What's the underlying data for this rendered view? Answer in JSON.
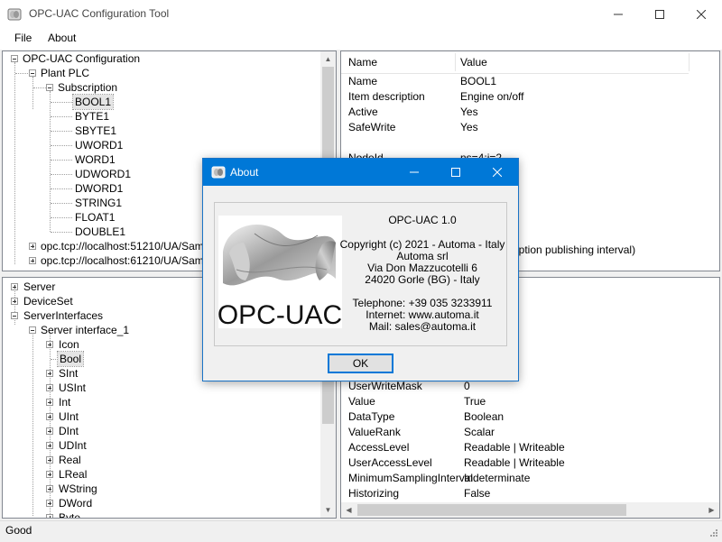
{
  "window": {
    "title": "OPC-UAC Configuration Tool"
  },
  "menu": [
    "File",
    "About"
  ],
  "tree_top": {
    "root": "OPC-UAC Configuration",
    "plc": "Plant PLC",
    "subscription": "Subscription",
    "items": [
      "BOOL1",
      "BYTE1",
      "SBYTE1",
      "UWORD1",
      "WORD1",
      "UDWORD1",
      "DWORD1",
      "STRING1",
      "FLOAT1",
      "DOUBLE1"
    ],
    "servers": [
      "opc.tcp://localhost:51210/UA/Sampl",
      "opc.tcp://localhost:61210/UA/Sampl"
    ]
  },
  "tree_bottom": {
    "top_nodes": [
      "Server",
      "DeviceSet",
      "ServerInterfaces"
    ],
    "interface": "Server interface_1",
    "items": [
      "Icon",
      "Bool",
      "SInt",
      "USInt",
      "Int",
      "UInt",
      "DInt",
      "UDInt",
      "Real",
      "LReal",
      "WString",
      "DWord",
      "Byte"
    ]
  },
  "grid_top": {
    "col_name": "Name",
    "col_value": "Value",
    "rows": [
      {
        "name": "Name",
        "value": "BOOL1"
      },
      {
        "name": "Item description",
        "value": "Engine on/off"
      },
      {
        "name": "Active",
        "value": "Yes"
      },
      {
        "name": "SafeWrite",
        "value": "Yes"
      }
    ],
    "partial_row_name": "NodeId",
    "partial_row_value": "ns=4;i=2",
    "partial_desc": "ription publishing interval)"
  },
  "grid_bottom": {
    "rows": [
      {
        "name": "UserWriteMask",
        "value": "0"
      },
      {
        "name": "Value",
        "value": "True"
      },
      {
        "name": "DataType",
        "value": "Boolean"
      },
      {
        "name": "ValueRank",
        "value": "Scalar"
      },
      {
        "name": "AccessLevel",
        "value": "Readable | Writeable"
      },
      {
        "name": "UserAccessLevel",
        "value": "Readable | Writeable"
      },
      {
        "name": "MinimumSamplingInterval",
        "value": "Indeterminate"
      },
      {
        "name": "Historizing",
        "value": "False"
      }
    ]
  },
  "status": "Good",
  "dialog": {
    "title": "About",
    "product": "OPC-UAC 1.0",
    "copyright": "Copyright (c) 2021 - Automa - Italy",
    "company": "Automa srl",
    "street": "Via Don Mazzucotelli 6",
    "city": "24020 Gorle (BG) - Italy",
    "phone": "Telephone: +39 035 3233911",
    "internet": "Internet: www.automa.it",
    "mail": "Mail: sales@automa.it",
    "logo_text": "OPC-UAC",
    "ok_label": "OK"
  },
  "colors": {
    "dialog_title_bg": "#0078d7",
    "accent": "#0078d7"
  }
}
